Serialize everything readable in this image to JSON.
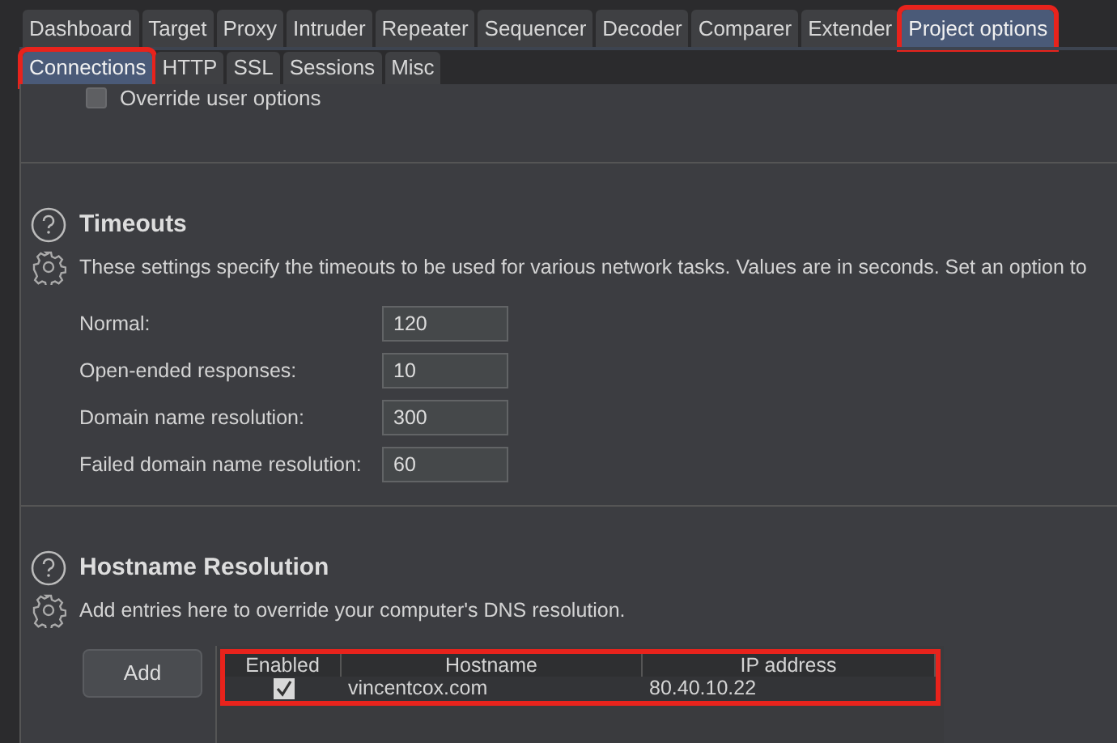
{
  "tabs": [
    {
      "label": "Dashboard",
      "selected": false,
      "highlighted": false
    },
    {
      "label": "Target",
      "selected": false,
      "highlighted": false
    },
    {
      "label": "Proxy",
      "selected": false,
      "highlighted": false
    },
    {
      "label": "Intruder",
      "selected": false,
      "highlighted": false
    },
    {
      "label": "Repeater",
      "selected": false,
      "highlighted": false
    },
    {
      "label": "Sequencer",
      "selected": false,
      "highlighted": false
    },
    {
      "label": "Decoder",
      "selected": false,
      "highlighted": false
    },
    {
      "label": "Comparer",
      "selected": false,
      "highlighted": false
    },
    {
      "label": "Extender",
      "selected": false,
      "highlighted": false
    },
    {
      "label": "Project options",
      "selected": true,
      "highlighted": true
    }
  ],
  "subtabs": [
    {
      "label": "Connections",
      "selected": true,
      "highlighted": true
    },
    {
      "label": "HTTP",
      "selected": false,
      "highlighted": false
    },
    {
      "label": "SSL",
      "selected": false,
      "highlighted": false
    },
    {
      "label": "Sessions",
      "selected": false,
      "highlighted": false
    },
    {
      "label": "Misc",
      "selected": false,
      "highlighted": false
    }
  ],
  "override": {
    "label": "Override user options",
    "checked": false
  },
  "timeouts": {
    "title": "Timeouts",
    "description": "These settings specify the timeouts to be used for various network tasks. Values are in seconds. Set an option to",
    "fields": [
      {
        "label": "Normal:",
        "value": "120"
      },
      {
        "label": "Open-ended responses:",
        "value": "10"
      },
      {
        "label": "Domain name resolution:",
        "value": "300"
      },
      {
        "label": "Failed domain name resolution:",
        "value": "60"
      }
    ]
  },
  "hostname_resolution": {
    "title": "Hostname Resolution",
    "description": "Add entries here to override your computer's DNS resolution.",
    "add_button": "Add",
    "table": {
      "highlighted": true,
      "columns": [
        "Enabled",
        "Hostname",
        "IP address"
      ],
      "rows": [
        {
          "enabled": true,
          "hostname": "vincentcox.com",
          "ip_address": "80.40.10.22"
        }
      ]
    }
  }
}
